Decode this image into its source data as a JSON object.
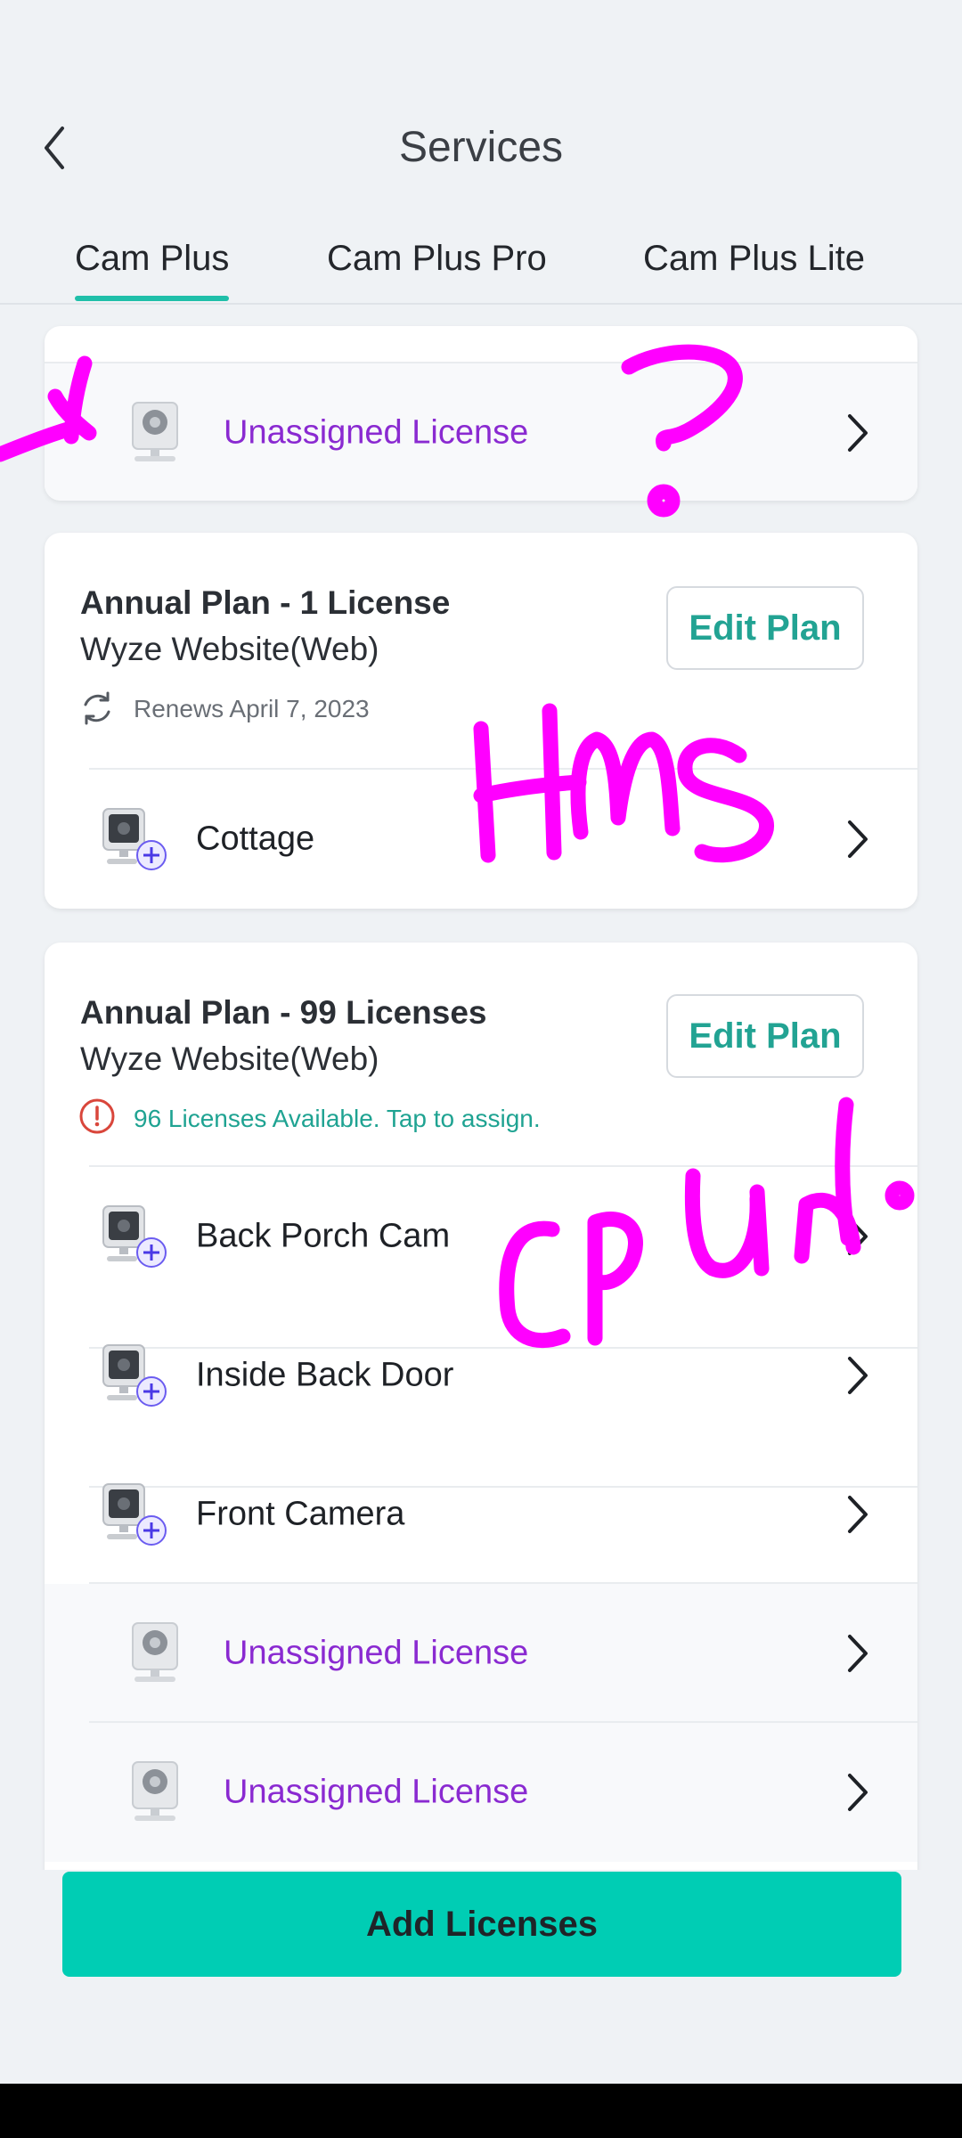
{
  "header": {
    "title": "Services",
    "back_icon": "chevron-left-icon",
    "tabs": [
      {
        "label": "Cam Plus",
        "active": true
      },
      {
        "label": "Cam Plus Pro",
        "active": false
      },
      {
        "label": "Cam Plus Lite",
        "active": false
      }
    ]
  },
  "top_card": {
    "rows": [
      {
        "label": "Unassigned License",
        "icon": "camera-icon"
      }
    ]
  },
  "plans": [
    {
      "title": "Annual Plan - 1 License",
      "source": "Wyze Website(Web)",
      "note": "Renews April 7, 2023",
      "note_icon": "renew-icon",
      "edit_label": "Edit Plan",
      "devices": [
        {
          "label": "Cottage",
          "icon": "camera-add-icon"
        }
      ]
    },
    {
      "title": "Annual Plan - 99 Licenses",
      "source": "Wyze Website(Web)",
      "note": "96 Licenses Available. Tap to assign.",
      "note_icon": "alert-icon",
      "edit_label": "Edit Plan",
      "devices": [
        {
          "label": "Back Porch Cam",
          "icon": "camera-add-icon"
        },
        {
          "label": "Inside Back Door",
          "icon": "camera-add-icon"
        },
        {
          "label": "Front Camera",
          "icon": "camera-add-icon"
        },
        {
          "label": "Unassigned License",
          "icon": "camera-icon"
        },
        {
          "label": "Unassigned License",
          "icon": "camera-icon"
        }
      ]
    }
  ],
  "footer": {
    "add_label": "Add Licenses"
  },
  "colors": {
    "accent_teal": "#00cdb4",
    "edit_text": "#22a393",
    "unassigned_text": "#8a2ad1",
    "annotation_magenta": "#ff00ff"
  }
}
